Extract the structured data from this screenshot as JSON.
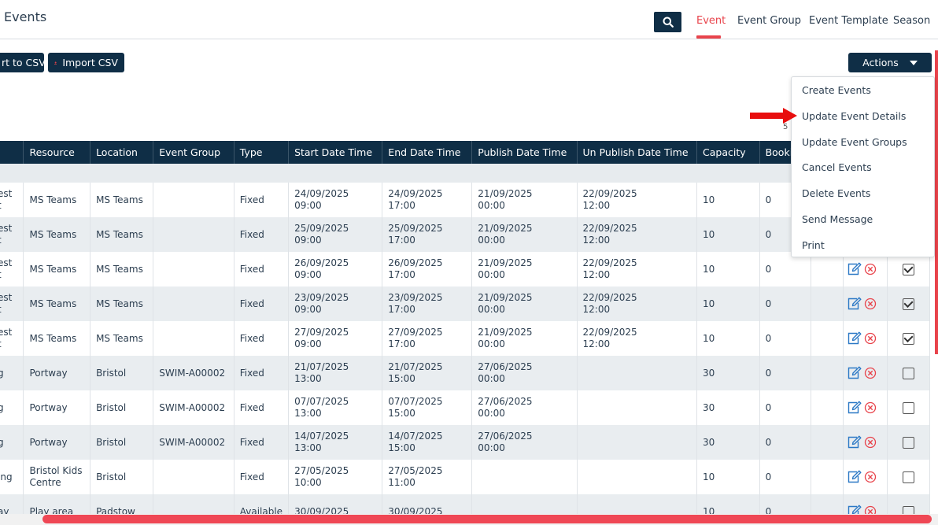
{
  "header": {
    "title": "Events",
    "tabs": [
      {
        "label": "Event",
        "active": true
      },
      {
        "label": "Event Group"
      },
      {
        "label": "Event Template"
      },
      {
        "label": "Season"
      }
    ]
  },
  "toolbar": {
    "export_label": "rt to CSV",
    "import_label": "Import CSV",
    "actions_label": "Actions"
  },
  "count_fragment": "5",
  "actions_menu": [
    "Create Events",
    "Update Event Details",
    "Update Event Groups",
    "Cancel Events",
    "Delete Events",
    "Send Message",
    "Print"
  ],
  "table": {
    "columns": [
      "",
      "Resource",
      "Location",
      "Event Group",
      "Type",
      "Start Date Time",
      "End Date Time",
      "Publish Date Time",
      "Un Publish Date Time",
      "Capacity",
      "Bookin",
      "",
      "",
      ""
    ],
    "rows": [
      {
        "name": "est\nt",
        "resource": "MS Teams",
        "location": "MS Teams",
        "group": "",
        "type": "Fixed",
        "start": "24/09/2025\n09:00",
        "end": "24/09/2025\n17:00",
        "publish": "21/09/2025\n00:00",
        "unpublish": "22/09/2025\n12:00",
        "capacity": "10",
        "bookings": "0",
        "checked": false
      },
      {
        "name": "est\nt",
        "resource": "MS Teams",
        "location": "MS Teams",
        "group": "",
        "type": "Fixed",
        "start": "25/09/2025\n09:00",
        "end": "25/09/2025\n17:00",
        "publish": "21/09/2025\n00:00",
        "unpublish": "22/09/2025\n12:00",
        "capacity": "10",
        "bookings": "0",
        "checked": false
      },
      {
        "name": "est\nt",
        "resource": "MS Teams",
        "location": "MS Teams",
        "group": "",
        "type": "Fixed",
        "start": "26/09/2025\n09:00",
        "end": "26/09/2025\n17:00",
        "publish": "21/09/2025\n00:00",
        "unpublish": "22/09/2025\n12:00",
        "capacity": "10",
        "bookings": "0",
        "checked": true
      },
      {
        "name": "est\nt",
        "resource": "MS Teams",
        "location": "MS Teams",
        "group": "",
        "type": "Fixed",
        "start": "23/09/2025\n09:00",
        "end": "23/09/2025\n17:00",
        "publish": "21/09/2025\n00:00",
        "unpublish": "22/09/2025\n12:00",
        "capacity": "10",
        "bookings": "0",
        "checked": true
      },
      {
        "name": "est\nt",
        "resource": "MS Teams",
        "location": "MS Teams",
        "group": "",
        "type": "Fixed",
        "start": "27/09/2025\n09:00",
        "end": "27/09/2025\n17:00",
        "publish": "21/09/2025\n00:00",
        "unpublish": "22/09/2025\n12:00",
        "capacity": "10",
        "bookings": "0",
        "checked": true
      },
      {
        "name": "g",
        "resource": "Portway",
        "location": "Bristol",
        "group": "SWIM-A00002",
        "type": "Fixed",
        "start": "21/07/2025\n13:00",
        "end": "21/07/2025\n15:00",
        "publish": "27/06/2025\n00:00",
        "unpublish": "",
        "capacity": "30",
        "bookings": "0",
        "checked": false
      },
      {
        "name": "g",
        "resource": "Portway",
        "location": "Bristol",
        "group": "SWIM-A00002",
        "type": "Fixed",
        "start": "07/07/2025\n13:00",
        "end": "07/07/2025\n15:00",
        "publish": "27/06/2025\n00:00",
        "unpublish": "",
        "capacity": "30",
        "bookings": "0",
        "checked": false
      },
      {
        "name": "g",
        "resource": "Portway",
        "location": "Bristol",
        "group": "SWIM-A00002",
        "type": "Fixed",
        "start": "14/07/2025\n13:00",
        "end": "14/07/2025\n15:00",
        "publish": "27/06/2025\n00:00",
        "unpublish": "",
        "capacity": "30",
        "bookings": "0",
        "checked": false
      },
      {
        "name": "ing",
        "resource": "Bristol Kids\nCentre",
        "location": "Bristol",
        "group": "",
        "type": "Fixed",
        "start": "27/05/2025\n10:00",
        "end": "27/05/2025\n11:00",
        "publish": "",
        "unpublish": "",
        "capacity": "10",
        "bookings": "0",
        "checked": false
      },
      {
        "name": "ay",
        "resource": "Play area",
        "location": "Padstow",
        "group": "",
        "type": "Available",
        "start": "30/09/2025",
        "end": "30/09/2025",
        "publish": "",
        "unpublish": "",
        "capacity": "10",
        "bookings": "0",
        "checked": false
      }
    ]
  },
  "colors": {
    "navy": "#0f2e46",
    "accent": "#e8434b"
  }
}
